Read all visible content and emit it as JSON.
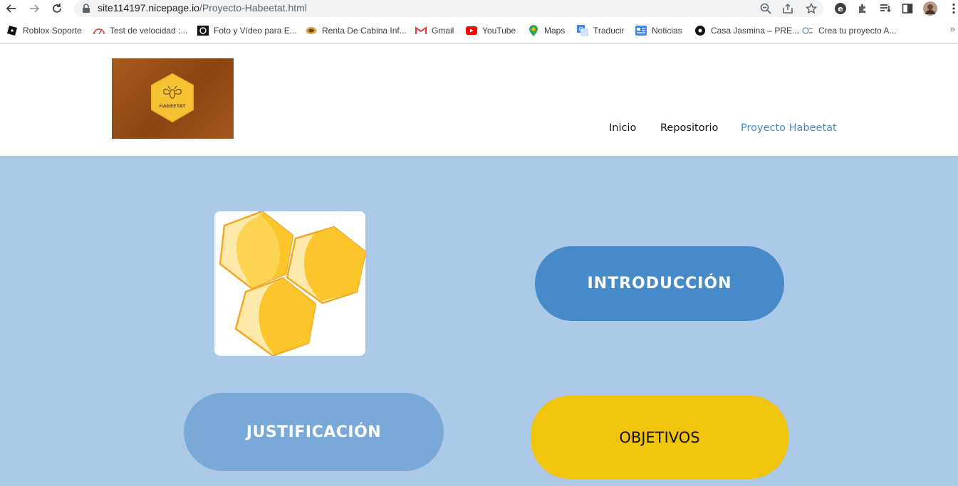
{
  "browser": {
    "url_host": "site114197.nicepage.io",
    "url_path": "/Proyecto-Habeetat.html",
    "bookmarks": [
      {
        "label": "Roblox Soporte",
        "icon": "roblox-icon"
      },
      {
        "label": "Test de velocidad :...",
        "icon": "speedtest-icon"
      },
      {
        "label": "Foto y Vídeo para E...",
        "icon": "photo-video-icon"
      },
      {
        "label": "Renta De Cabina Inf...",
        "icon": "cabin-icon"
      },
      {
        "label": "Gmail",
        "icon": "gmail-icon"
      },
      {
        "label": "YouTube",
        "icon": "youtube-icon"
      },
      {
        "label": "Maps",
        "icon": "maps-icon"
      },
      {
        "label": "Traducir",
        "icon": "translate-icon"
      },
      {
        "label": "Noticias",
        "icon": "news-icon"
      },
      {
        "label": "Casa Jasmina – PRE...",
        "icon": "casa-jasmina-icon"
      },
      {
        "label": "Crea tu proyecto A...",
        "icon": "project-icon"
      }
    ],
    "more": "»"
  },
  "site": {
    "logo_text": "HABEETAT",
    "nav": [
      {
        "label": "Inicio",
        "active": false
      },
      {
        "label": "Repositorio",
        "active": false
      },
      {
        "label": "Proyecto Habeetat",
        "active": true
      }
    ]
  },
  "main": {
    "intro_label": "INTRODUCCIÓN",
    "justification_label": "JUSTIFICACIÓN",
    "objectives_label": "OBJETIVOS"
  },
  "colors": {
    "accent_blue": "#478ac9",
    "light_blue": "#78a9d9",
    "section_bg": "#acc9e7",
    "yellow": "#f1c50e"
  }
}
